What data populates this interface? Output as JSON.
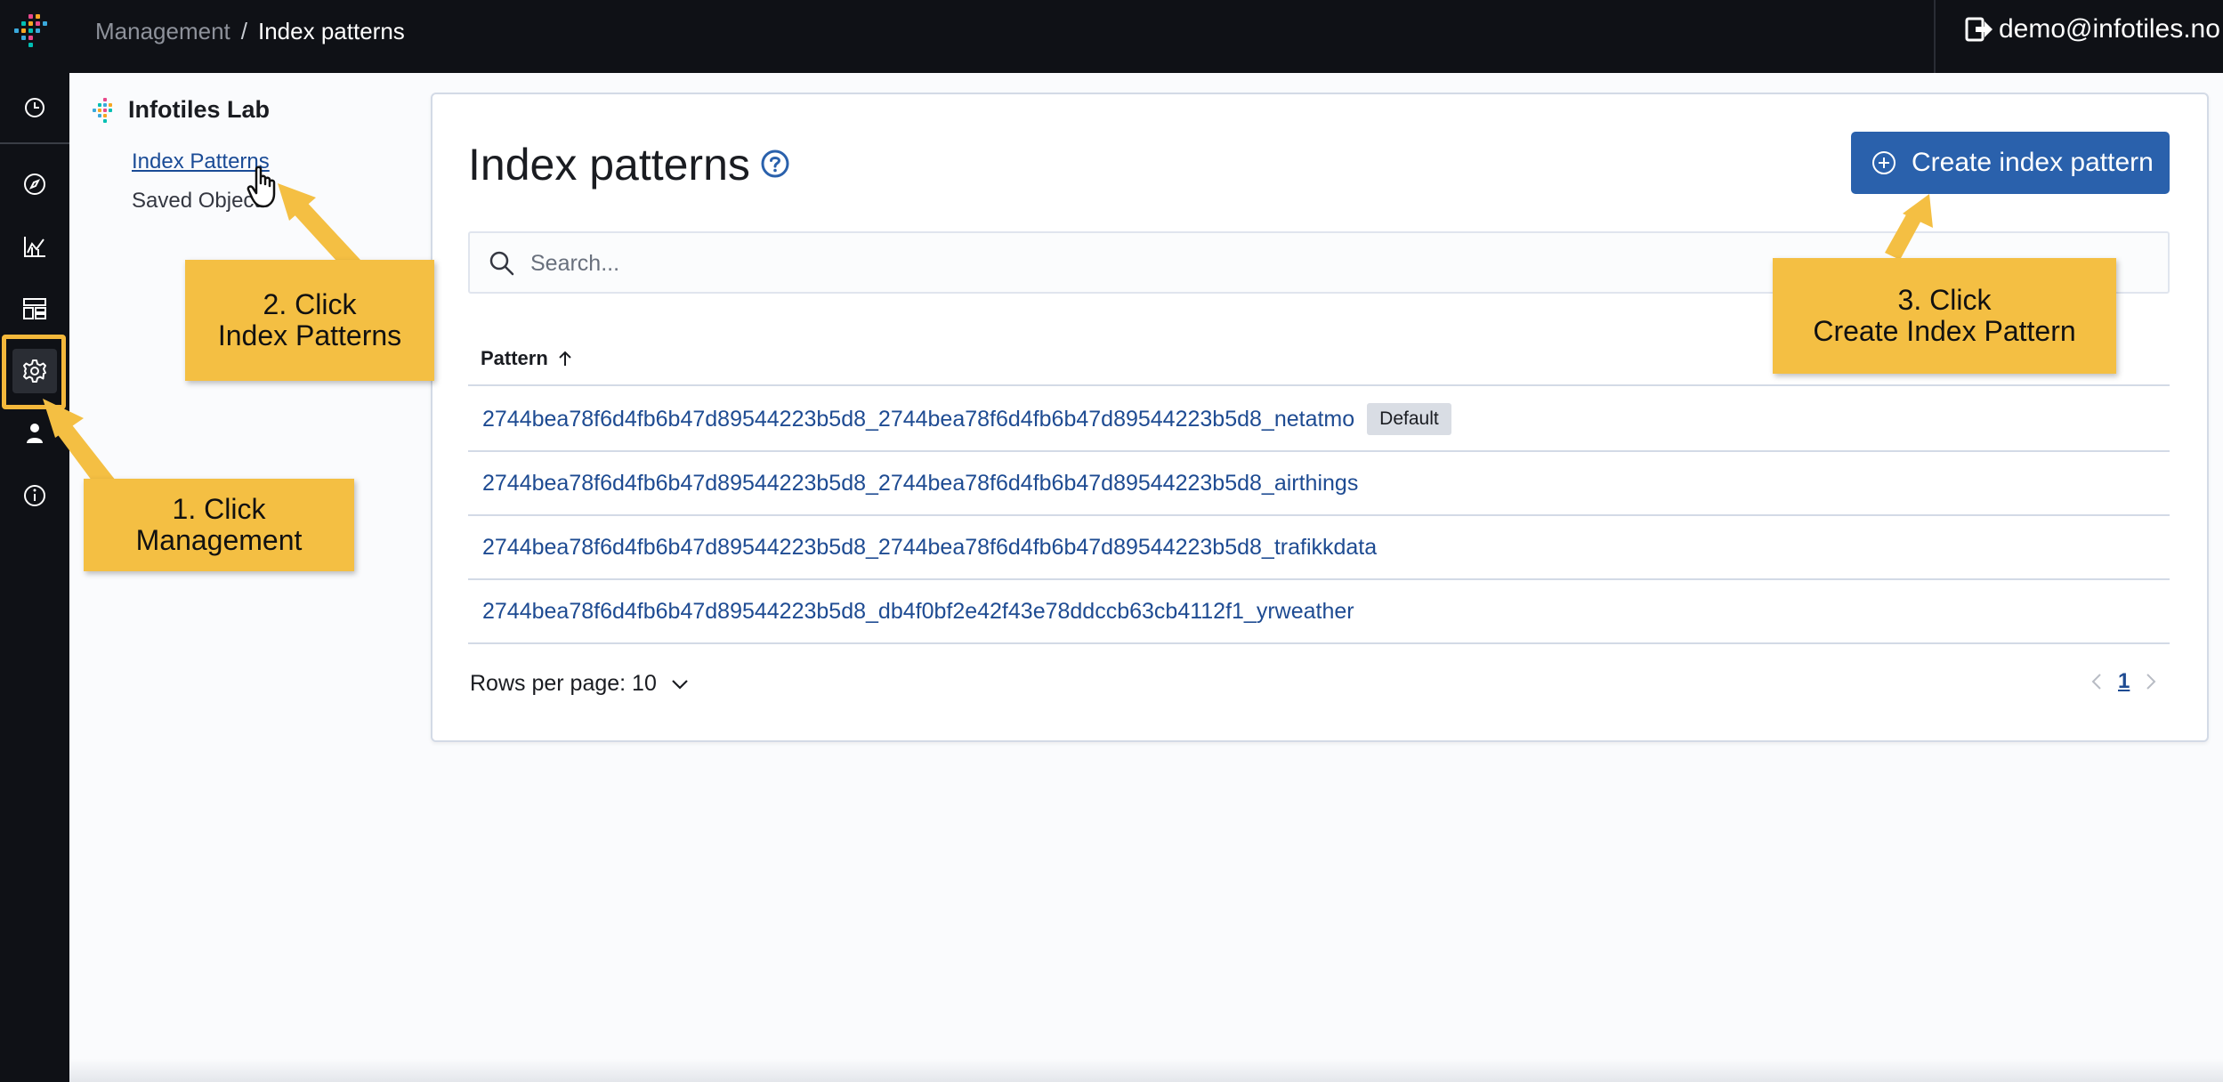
{
  "header": {
    "breadcrumbs": [
      "Management",
      "/",
      "Index patterns"
    ],
    "user_label": "demo@infotiles.no",
    "colors": {
      "bar": "#0f1116",
      "text": "#ffffff"
    }
  },
  "rail": {
    "items": [
      "recent-clock-icon",
      "discover-compass-icon",
      "visualize-chart-icon",
      "dashboard-icon",
      "management-gear-icon",
      "user-icon",
      "info-icon"
    ]
  },
  "sidenav": {
    "title": "Infotiles Lab",
    "items": [
      {
        "label": "Index Patterns",
        "active": true
      },
      {
        "label": "Saved Objects",
        "active": false
      }
    ]
  },
  "main": {
    "title": "Index patterns",
    "create_button": "Create index pattern",
    "search": {
      "placeholder": "Search...",
      "value": ""
    },
    "table": {
      "column": "Pattern",
      "sort": "ascending",
      "rows": [
        {
          "pattern": "2744bea78f6d4fb6b47d89544223b5d8_2744bea78f6d4fb6b47d89544223b5d8_netatmo",
          "badge": "Default"
        },
        {
          "pattern": "2744bea78f6d4fb6b47d89544223b5d8_2744bea78f6d4fb6b47d89544223b5d8_airthings",
          "badge": ""
        },
        {
          "pattern": "2744bea78f6d4fb6b47d89544223b5d8_2744bea78f6d4fb6b47d89544223b5d8_trafikkdata",
          "badge": ""
        },
        {
          "pattern": "2744bea78f6d4fb6b47d89544223b5d8_db4f0bf2e42f43e78ddccb63cb4112f1_yrweather",
          "badge": ""
        }
      ]
    },
    "rows_per_page": "Rows per page: 10",
    "pagination": {
      "current_page": "1"
    },
    "colors": {
      "primary": "#2a61ac",
      "link": "#1e4b92"
    }
  },
  "callouts": {
    "step1": {
      "line1": "1. Click",
      "line2": "Management"
    },
    "step2": {
      "line1": "2. Click",
      "line2": "Index Patterns"
    },
    "step3": {
      "line1": "3. Click",
      "line2": "Create Index Pattern"
    },
    "color": "#f4bf43"
  }
}
